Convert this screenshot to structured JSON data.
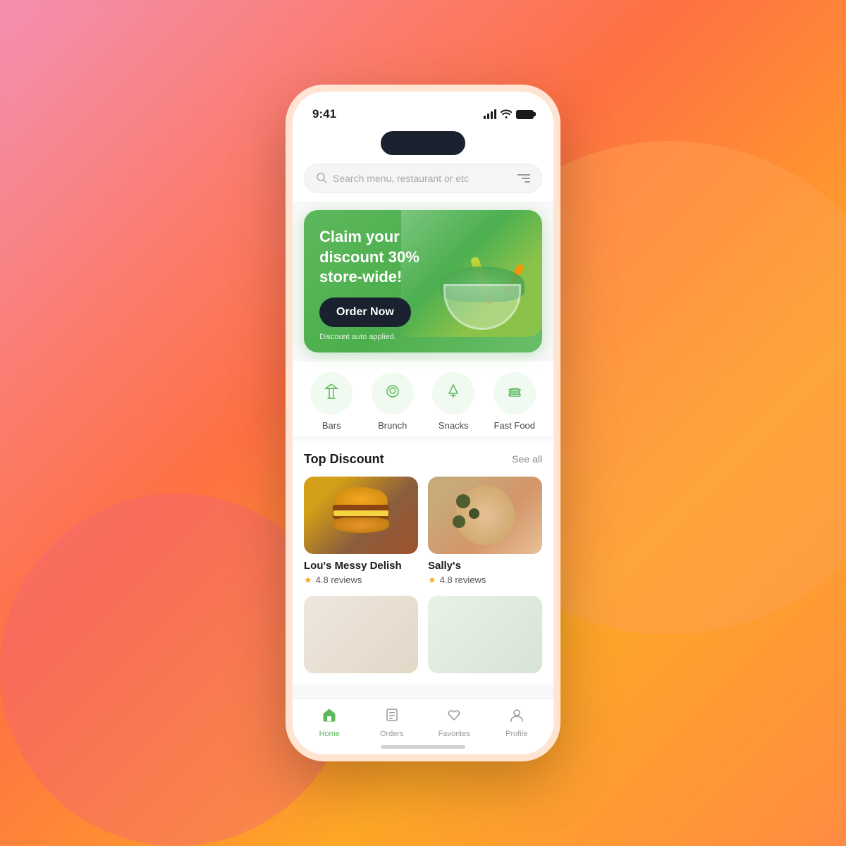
{
  "background": {
    "gradient": "linear-gradient(135deg, #f48fb1 0%, #ff7043 40%, #ffa726 70%, #ff8c42 100%)"
  },
  "phone": {
    "status_bar": {
      "time": "9:41",
      "signal_label": "signal-bars",
      "wifi_label": "wifi-icon",
      "battery_label": "battery-icon"
    },
    "search": {
      "placeholder": "Search menu, restaurant or etc"
    },
    "promo_banner": {
      "title": "Claim your discount 30% store-wide!",
      "button_label": "Order Now",
      "footnote": "Discount auto applied."
    },
    "categories": [
      {
        "id": "bars",
        "label": "Bars",
        "icon": "cocktail"
      },
      {
        "id": "brunch",
        "label": "Brunch",
        "icon": "egg"
      },
      {
        "id": "snacks",
        "label": "Snacks",
        "icon": "pizza-slice"
      },
      {
        "id": "fast-food",
        "label": "Fast Food",
        "icon": "burger"
      }
    ],
    "top_discount": {
      "section_title": "Top Discount",
      "see_all": "See all",
      "restaurants": [
        {
          "id": "lous-messy-delish",
          "name": "Lou's Messy Delish",
          "rating": "4.8 reviews",
          "type": "burger"
        },
        {
          "id": "sallys",
          "name": "Sally's",
          "rating": "4.8 reviews",
          "type": "pizza"
        }
      ]
    },
    "bottom_nav": {
      "items": [
        {
          "id": "home",
          "label": "Home",
          "active": true
        },
        {
          "id": "orders",
          "label": "Orders",
          "active": false
        },
        {
          "id": "favorites",
          "label": "Favorites",
          "active": false
        },
        {
          "id": "profile",
          "label": "Profile",
          "active": false
        }
      ]
    }
  }
}
